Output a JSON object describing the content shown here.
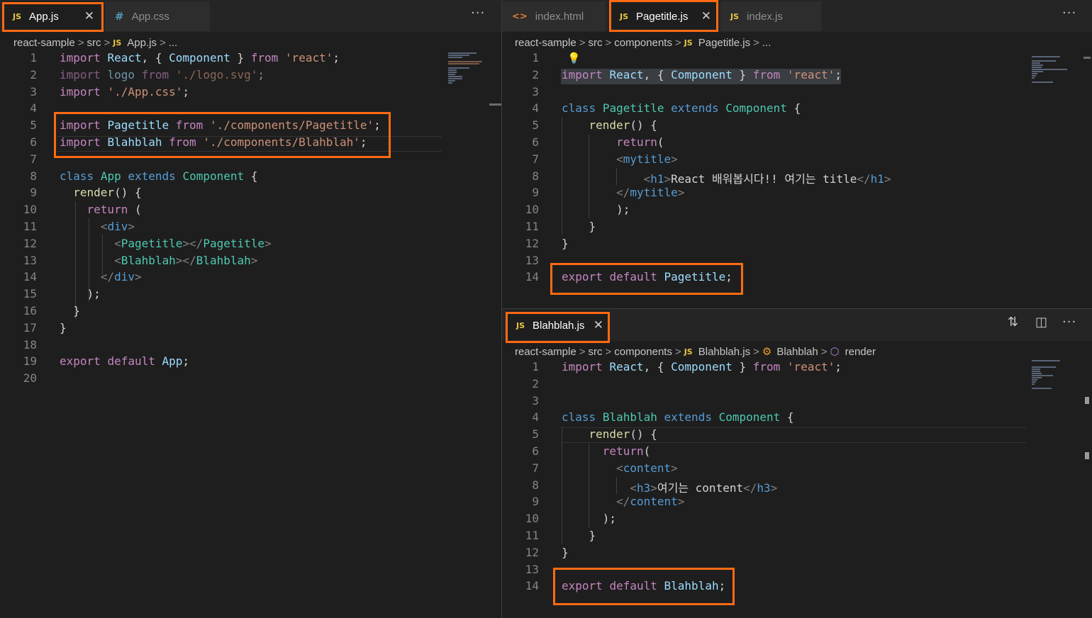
{
  "left_pane": {
    "tabs": [
      {
        "icon": "JS",
        "label": "App.js",
        "active": true,
        "close": "✕"
      },
      {
        "icon": "#",
        "label": "App.css",
        "active": false
      }
    ],
    "more": "···",
    "breadcrumb": {
      "parts": [
        "react-sample",
        "src"
      ],
      "file_icon": "JS",
      "file": "App.js",
      "ellipsis": "..."
    },
    "line_numbers": [
      "1",
      "2",
      "3",
      "4",
      "5",
      "6",
      "7",
      "8",
      "9",
      "10",
      "11",
      "12",
      "13",
      "14",
      "15",
      "16",
      "17",
      "18",
      "19",
      "20"
    ],
    "code": [
      [
        {
          "t": "import",
          "c": "p"
        },
        {
          "t": " "
        },
        {
          "t": "React",
          "c": "v"
        },
        {
          "t": ", { "
        },
        {
          "t": "Component",
          "c": "v"
        },
        {
          "t": " } "
        },
        {
          "t": "from",
          "c": "p"
        },
        {
          "t": " "
        },
        {
          "t": "'react'",
          "c": "s"
        },
        {
          "t": ";"
        }
      ],
      [
        {
          "t": "import",
          "c": "p"
        },
        {
          "t": " "
        },
        {
          "t": "logo",
          "c": "v"
        },
        {
          "t": " "
        },
        {
          "t": "from",
          "c": "p"
        },
        {
          "t": " "
        },
        {
          "t": "'./logo.svg'",
          "c": "s"
        },
        {
          "t": ";"
        }
      ],
      [
        {
          "t": "import",
          "c": "p"
        },
        {
          "t": " "
        },
        {
          "t": "'./App.css'",
          "c": "s"
        },
        {
          "t": ";"
        }
      ],
      [],
      [
        {
          "t": "import",
          "c": "p"
        },
        {
          "t": " "
        },
        {
          "t": "Pagetitle",
          "c": "v"
        },
        {
          "t": " "
        },
        {
          "t": "from",
          "c": "p"
        },
        {
          "t": " "
        },
        {
          "t": "'./components/Pagetitle'",
          "c": "s"
        },
        {
          "t": ";"
        }
      ],
      [
        {
          "t": "import",
          "c": "p"
        },
        {
          "t": " "
        },
        {
          "t": "Blahblah",
          "c": "v"
        },
        {
          "t": " "
        },
        {
          "t": "from",
          "c": "p"
        },
        {
          "t": " "
        },
        {
          "t": "'./components/Blahblah'",
          "c": "s"
        },
        {
          "t": ";"
        }
      ],
      [],
      [
        {
          "t": "class",
          "c": "k"
        },
        {
          "t": " "
        },
        {
          "t": "App",
          "c": "c"
        },
        {
          "t": " "
        },
        {
          "t": "extends",
          "c": "k"
        },
        {
          "t": " "
        },
        {
          "t": "Component",
          "c": "c"
        },
        {
          "t": " {"
        }
      ],
      [
        {
          "t": "  "
        },
        {
          "t": "render",
          "c": "f"
        },
        {
          "t": "() {"
        }
      ],
      [
        {
          "t": "    "
        },
        {
          "t": "return",
          "c": "p"
        },
        {
          "t": " ("
        }
      ],
      [
        {
          "t": "      "
        },
        {
          "t": "<",
          "c": "g"
        },
        {
          "t": "div",
          "c": "k"
        },
        {
          "t": ">",
          "c": "g"
        }
      ],
      [
        {
          "t": "        "
        },
        {
          "t": "<",
          "c": "g"
        },
        {
          "t": "Pagetitle",
          "c": "c"
        },
        {
          "t": "></",
          "c": "g"
        },
        {
          "t": "Pagetitle",
          "c": "c"
        },
        {
          "t": ">",
          "c": "g"
        }
      ],
      [
        {
          "t": "        "
        },
        {
          "t": "<",
          "c": "g"
        },
        {
          "t": "Blahblah",
          "c": "c"
        },
        {
          "t": "></",
          "c": "g"
        },
        {
          "t": "Blahblah",
          "c": "c"
        },
        {
          "t": ">",
          "c": "g"
        }
      ],
      [
        {
          "t": "      "
        },
        {
          "t": "</",
          "c": "g"
        },
        {
          "t": "div",
          "c": "k"
        },
        {
          "t": ">",
          "c": "g"
        }
      ],
      [
        {
          "t": "    );"
        }
      ],
      [
        {
          "t": "  }"
        }
      ],
      [
        {
          "t": "}"
        }
      ],
      [],
      [
        {
          "t": "export",
          "c": "p"
        },
        {
          "t": " "
        },
        {
          "t": "default",
          "c": "p"
        },
        {
          "t": " "
        },
        {
          "t": "App",
          "c": "v"
        },
        {
          "t": ";"
        }
      ],
      []
    ]
  },
  "top_right_pane": {
    "tabs": [
      {
        "icon": "<>",
        "label": "index.html",
        "active": false
      },
      {
        "icon": "JS",
        "label": "Pagetitle.js",
        "active": true,
        "close": "✕"
      },
      {
        "icon": "JS",
        "label": "index.js",
        "active": false
      }
    ],
    "more": "···",
    "breadcrumb": {
      "parts": [
        "react-sample",
        "src",
        "components"
      ],
      "file_icon": "JS",
      "file": "Pagetitle.js",
      "ellipsis": "..."
    },
    "line_numbers": [
      "1",
      "2",
      "3",
      "4",
      "5",
      "6",
      "7",
      "8",
      "9",
      "10",
      "11",
      "12",
      "13",
      "14"
    ],
    "code": [
      [],
      [
        {
          "t": "import",
          "c": "p"
        },
        {
          "t": " "
        },
        {
          "t": "React",
          "c": "v"
        },
        {
          "t": ", { "
        },
        {
          "t": "Component",
          "c": "v"
        },
        {
          "t": " } "
        },
        {
          "t": "from",
          "c": "p"
        },
        {
          "t": " "
        },
        {
          "t": "'react'",
          "c": "s"
        },
        {
          "t": ";"
        }
      ],
      [],
      [
        {
          "t": "class",
          "c": "k"
        },
        {
          "t": " "
        },
        {
          "t": "Pagetitle",
          "c": "c"
        },
        {
          "t": " "
        },
        {
          "t": "extends",
          "c": "k"
        },
        {
          "t": " "
        },
        {
          "t": "Component",
          "c": "c"
        },
        {
          "t": " {"
        }
      ],
      [
        {
          "t": "    "
        },
        {
          "t": "render",
          "c": "f"
        },
        {
          "t": "() {"
        }
      ],
      [
        {
          "t": "        "
        },
        {
          "t": "return",
          "c": "p"
        },
        {
          "t": "("
        }
      ],
      [
        {
          "t": "        "
        },
        {
          "t": "<",
          "c": "g"
        },
        {
          "t": "mytitle",
          "c": "k"
        },
        {
          "t": ">",
          "c": "g"
        }
      ],
      [
        {
          "t": "            "
        },
        {
          "t": "<",
          "c": "g"
        },
        {
          "t": "h1",
          "c": "k"
        },
        {
          "t": ">",
          "c": "g"
        },
        {
          "t": "React 배워봅시다!! 여기는 title"
        },
        {
          "t": "</",
          "c": "g"
        },
        {
          "t": "h1",
          "c": "k"
        },
        {
          "t": ">",
          "c": "g"
        }
      ],
      [
        {
          "t": "        "
        },
        {
          "t": "</",
          "c": "g"
        },
        {
          "t": "mytitle",
          "c": "k"
        },
        {
          "t": ">",
          "c": "g"
        }
      ],
      [
        {
          "t": "        );"
        }
      ],
      [
        {
          "t": "    }"
        }
      ],
      [
        {
          "t": "}"
        }
      ],
      [],
      [
        {
          "t": "export",
          "c": "p"
        },
        {
          "t": " "
        },
        {
          "t": "default",
          "c": "p"
        },
        {
          "t": " "
        },
        {
          "t": "Pagetitle",
          "c": "v"
        },
        {
          "t": ";"
        }
      ]
    ]
  },
  "bottom_right_pane": {
    "tabs": [
      {
        "icon": "JS",
        "label": "Blahblah.js",
        "active": true,
        "close": "✕"
      }
    ],
    "actions": {
      "compare": "⇅",
      "split": "◫",
      "more": "···"
    },
    "breadcrumb": {
      "parts": [
        "react-sample",
        "src",
        "components"
      ],
      "file_icon": "JS",
      "file": "Blahblah.js",
      "class_name": "Blahblah",
      "method": "render"
    },
    "line_numbers": [
      "1",
      "2",
      "3",
      "4",
      "5",
      "6",
      "7",
      "8",
      "9",
      "10",
      "11",
      "12",
      "13",
      "14"
    ],
    "code": [
      [
        {
          "t": "import",
          "c": "p"
        },
        {
          "t": " "
        },
        {
          "t": "React",
          "c": "v"
        },
        {
          "t": ", { "
        },
        {
          "t": "Component",
          "c": "v"
        },
        {
          "t": " } "
        },
        {
          "t": "from",
          "c": "p"
        },
        {
          "t": " "
        },
        {
          "t": "'react'",
          "c": "s"
        },
        {
          "t": ";"
        }
      ],
      [],
      [],
      [
        {
          "t": "class",
          "c": "k"
        },
        {
          "t": " "
        },
        {
          "t": "Blahblah",
          "c": "c"
        },
        {
          "t": " "
        },
        {
          "t": "extends",
          "c": "k"
        },
        {
          "t": " "
        },
        {
          "t": "Component",
          "c": "c"
        },
        {
          "t": " {"
        }
      ],
      [
        {
          "t": "    "
        },
        {
          "t": "render",
          "c": "f"
        },
        {
          "t": "() {"
        }
      ],
      [
        {
          "t": "      "
        },
        {
          "t": "return",
          "c": "p"
        },
        {
          "t": "("
        }
      ],
      [
        {
          "t": "        "
        },
        {
          "t": "<",
          "c": "g"
        },
        {
          "t": "content",
          "c": "k"
        },
        {
          "t": ">",
          "c": "g"
        }
      ],
      [
        {
          "t": "          "
        },
        {
          "t": "<",
          "c": "g"
        },
        {
          "t": "h3",
          "c": "k"
        },
        {
          "t": ">",
          "c": "g"
        },
        {
          "t": "여기는 content"
        },
        {
          "t": "</",
          "c": "g"
        },
        {
          "t": "h3",
          "c": "k"
        },
        {
          "t": ">",
          "c": "g"
        }
      ],
      [
        {
          "t": "        "
        },
        {
          "t": "</",
          "c": "g"
        },
        {
          "t": "content",
          "c": "k"
        },
        {
          "t": ">",
          "c": "g"
        }
      ],
      [
        {
          "t": "      );"
        }
      ],
      [
        {
          "t": "    }"
        }
      ],
      [
        {
          "t": "}"
        }
      ],
      [],
      [
        {
          "t": "export",
          "c": "p"
        },
        {
          "t": " "
        },
        {
          "t": "default",
          "c": "p"
        },
        {
          "t": " "
        },
        {
          "t": "Blahblah",
          "c": "v"
        },
        {
          "t": ";"
        }
      ]
    ]
  },
  "colors": {
    "highlight": "#ff6a13",
    "js_icon": "#e8c545",
    "keyword": "#569cd6",
    "control": "#c586c0",
    "string": "#ce9178",
    "class": "#4ec9b0",
    "function": "#dcdcaa",
    "variable": "#9cdcfe"
  }
}
